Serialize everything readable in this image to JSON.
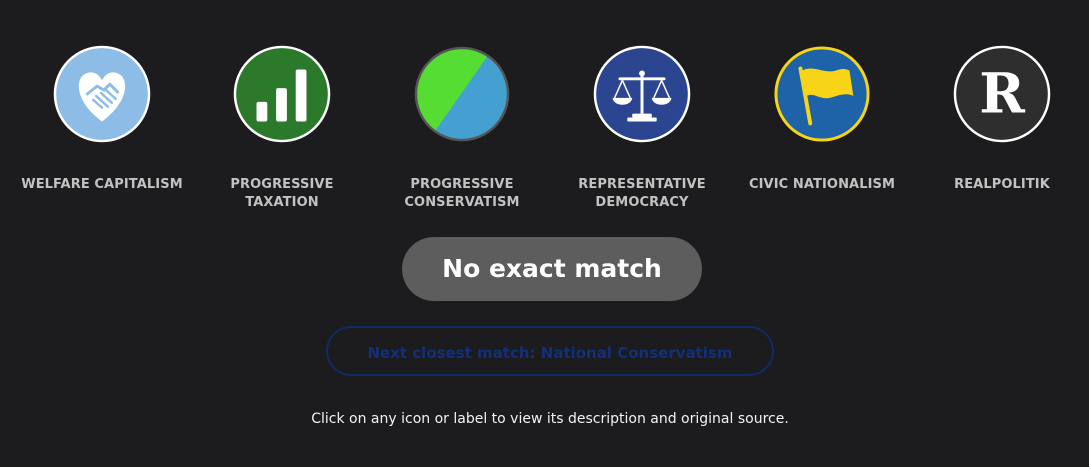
{
  "ideologies": [
    {
      "label": "WELFARE CAPITALISM",
      "icon": "handshake-heart-icon",
      "color": "#8dbde7"
    },
    {
      "label": "PROGRESSIVE TAXATION",
      "icon": "ascending-bars-icon",
      "color": "#2b7a2b"
    },
    {
      "label": "PROGRESSIVE CONSERVATISM",
      "icon": "split-green-blue-icon",
      "colors": [
        "#55dd33",
        "#44a0d0"
      ]
    },
    {
      "label": "REPRESENTATIVE DEMOCRACY",
      "icon": "scales-of-justice-icon",
      "color": "#2c4591"
    },
    {
      "label": "CIVIC NATIONALISM",
      "icon": "yellow-flag-icon",
      "colors": [
        "#1e63a8",
        "#f7d418"
      ]
    },
    {
      "label": "REALPOLITIK",
      "icon": "letter-r-icon",
      "color": "#2e2e2e",
      "glyph": "R"
    }
  ],
  "result": {
    "no_match_label": "No exact match",
    "next_match_label": "Next closest match: National Conservatism"
  },
  "hint": "Click on any icon or label to view its description and original source."
}
